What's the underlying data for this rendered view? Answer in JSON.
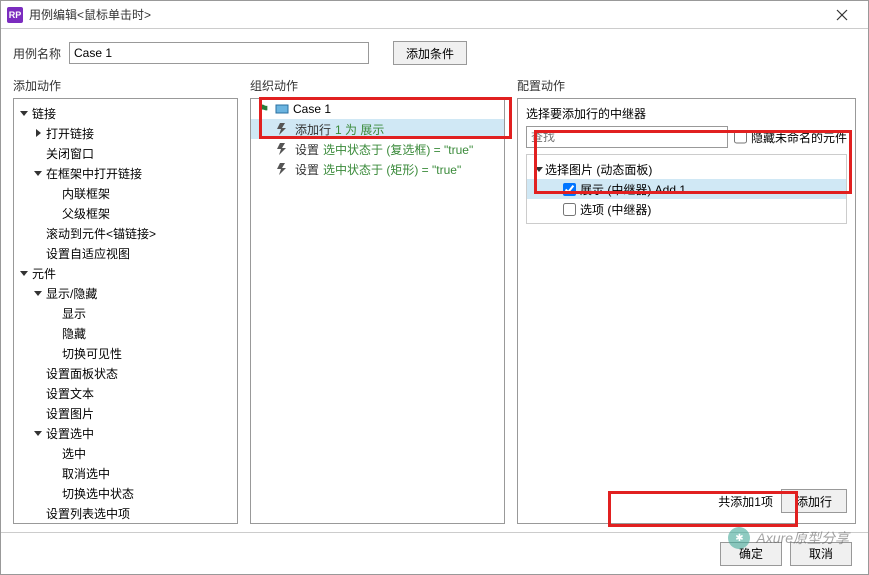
{
  "window": {
    "title": "用例编辑<鼠标单击时>",
    "app_icon_text": "RP"
  },
  "caseNameLabel": "用例名称",
  "caseNameValue": "Case 1",
  "addConditionBtn": "添加条件",
  "colHeaders": {
    "left": "添加动作",
    "mid": "组织动作",
    "right": "配置动作"
  },
  "leftTree": [
    {
      "label": "链接",
      "level": 0,
      "expandable": true,
      "open": true
    },
    {
      "label": "打开链接",
      "level": 1,
      "expandable": true,
      "open": false
    },
    {
      "label": "关闭窗口",
      "level": 1,
      "expandable": false
    },
    {
      "label": "在框架中打开链接",
      "level": 1,
      "expandable": true,
      "open": true
    },
    {
      "label": "内联框架",
      "level": 2,
      "expandable": false
    },
    {
      "label": "父级框架",
      "level": 2,
      "expandable": false
    },
    {
      "label": "滚动到元件<锚链接>",
      "level": 1,
      "expandable": false
    },
    {
      "label": "设置自适应视图",
      "level": 1,
      "expandable": false
    },
    {
      "label": "元件",
      "level": 0,
      "expandable": true,
      "open": true
    },
    {
      "label": "显示/隐藏",
      "level": 1,
      "expandable": true,
      "open": true
    },
    {
      "label": "显示",
      "level": 2,
      "expandable": false
    },
    {
      "label": "隐藏",
      "level": 2,
      "expandable": false
    },
    {
      "label": "切换可见性",
      "level": 2,
      "expandable": false
    },
    {
      "label": "设置面板状态",
      "level": 1,
      "expandable": false
    },
    {
      "label": "设置文本",
      "level": 1,
      "expandable": false
    },
    {
      "label": "设置图片",
      "level": 1,
      "expandable": false
    },
    {
      "label": "设置选中",
      "level": 1,
      "expandable": true,
      "open": true
    },
    {
      "label": "选中",
      "level": 2,
      "expandable": false
    },
    {
      "label": "取消选中",
      "level": 2,
      "expandable": false
    },
    {
      "label": "切换选中状态",
      "level": 2,
      "expandable": false
    },
    {
      "label": "设置列表选中项",
      "level": 1,
      "expandable": false
    }
  ],
  "midCase": {
    "flag": "⚑",
    "label": "Case 1"
  },
  "midActions": [
    {
      "name": "添加行",
      "param": "1 为 展示",
      "selected": true
    },
    {
      "name": "设置",
      "param": "选中状态于 (复选框) = \"true\"",
      "selected": false
    },
    {
      "name": "设置",
      "param": "选中状态于 (矩形) = \"true\"",
      "selected": false
    }
  ],
  "rightPanel": {
    "title": "选择要添加行的中继器",
    "searchPlaceholder": "查找",
    "hideUnnamedLabel": "隐藏未命名的元件",
    "tree": [
      {
        "label": "选择图片 (动态面板)",
        "level": 0,
        "expandable": true,
        "open": true,
        "checkbox": false
      },
      {
        "label": "展示 (中继器) Add 1",
        "level": 1,
        "checkbox": true,
        "checked": true,
        "selected": true
      },
      {
        "label": "选项 (中继器)",
        "level": 1,
        "checkbox": true,
        "checked": false
      }
    ],
    "summaryText": "共添加1项",
    "addRowBtn": "添加行"
  },
  "footer": {
    "ok": "确定",
    "cancel": "取消"
  },
  "watermark": "Axure原型分享"
}
